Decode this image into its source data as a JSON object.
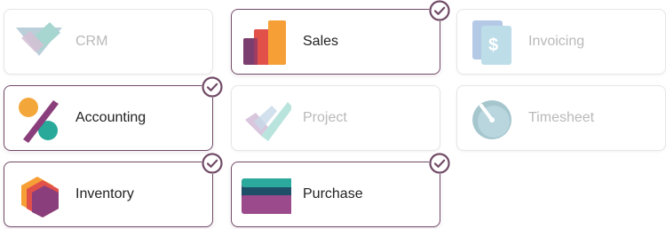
{
  "apps": [
    {
      "label": "CRM",
      "selected": false,
      "icon": "crm-icon"
    },
    {
      "label": "Sales",
      "selected": true,
      "icon": "sales-icon"
    },
    {
      "label": "Invoicing",
      "selected": false,
      "icon": "invoicing-icon"
    },
    {
      "label": "Accounting",
      "selected": true,
      "icon": "accounting-icon"
    },
    {
      "label": "Project",
      "selected": false,
      "icon": "project-icon"
    },
    {
      "label": "Timesheet",
      "selected": false,
      "icon": "timesheet-icon"
    },
    {
      "label": "Inventory",
      "selected": true,
      "icon": "inventory-icon"
    },
    {
      "label": "Purchase",
      "selected": true,
      "icon": "purchase-icon"
    }
  ],
  "colors": {
    "accent": "#714b67"
  }
}
